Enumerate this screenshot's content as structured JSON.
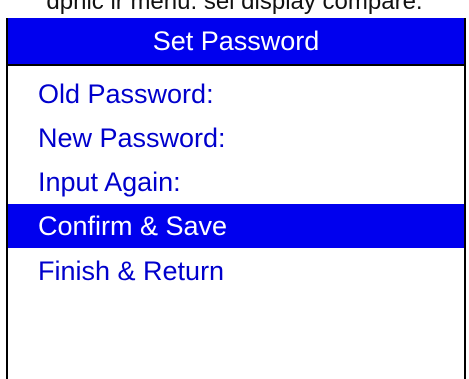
{
  "caption": "dphic ir menu. sel display compare.",
  "title": "Set Password",
  "menu": {
    "items": [
      {
        "label": "Old Password:",
        "selected": false
      },
      {
        "label": "New Password:",
        "selected": false
      },
      {
        "label": "Input Again:",
        "selected": false
      },
      {
        "label": "Confirm & Save",
        "selected": true
      },
      {
        "label": "Finish & Return",
        "selected": false
      }
    ]
  },
  "colors": {
    "title_bg": "#0000ee",
    "title_text": "#ffffff",
    "item_text": "#0000cc",
    "selected_bg": "#0000ee",
    "selected_text": "#ffffff"
  }
}
